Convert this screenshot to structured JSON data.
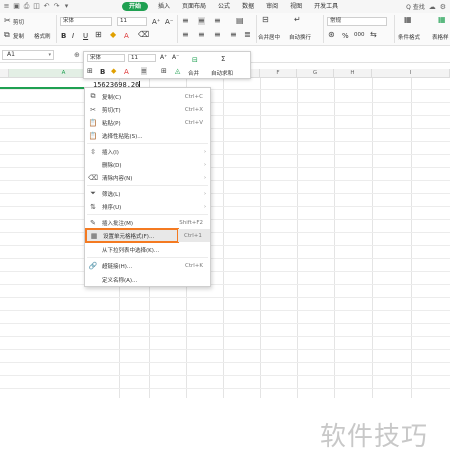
{
  "tabs": {
    "file_menu": "≡",
    "items": [
      "开始",
      "插入",
      "页面布局",
      "公式",
      "数据",
      "审阅",
      "视图",
      "开发工具"
    ],
    "active": "开始",
    "search": "Q 查找"
  },
  "ribbon": {
    "cut": "剪切",
    "copy": "复制",
    "format_painter": "格式刷",
    "paste": "粘贴",
    "font_name": "宋体",
    "font_size": "11",
    "style_name": "常规",
    "merge_center": "合并居中",
    "auto_wrap": "自动换行",
    "conditional_format": "条件格式",
    "table_style": "表格样",
    "bold": "B",
    "italic": "I",
    "underline": "U",
    "percent": "%",
    "thousands": "000"
  },
  "formula_bar": {
    "cell_ref": "A1",
    "zoom_icon": "⊕"
  },
  "mini_toolbar": {
    "font_name": "宋体",
    "font_size": "11",
    "grow_font": "A⁺",
    "shrink_font": "A⁻",
    "bold": "B",
    "merge": "合并",
    "autosum": "自动求和"
  },
  "columns": [
    "A",
    "B",
    "C",
    "D",
    "E",
    "F",
    "G",
    "H",
    "I"
  ],
  "cell_value": "15623698.26",
  "context_menu": [
    {
      "icon": "⧉",
      "label": "复制(C)",
      "shortcut": "Ctrl+C",
      "arrow": ""
    },
    {
      "icon": "✂",
      "label": "剪切(T)",
      "shortcut": "Ctrl+X",
      "arrow": ""
    },
    {
      "icon": "📋",
      "label": "粘贴(P)",
      "shortcut": "Ctrl+V",
      "arrow": ""
    },
    {
      "icon": "📋",
      "label": "选择性粘贴(S)...",
      "shortcut": "",
      "arrow": ""
    },
    {
      "icon": "⇳",
      "label": "插入(I)",
      "shortcut": "",
      "arrow": "›"
    },
    {
      "icon": "",
      "label": "删除(D)",
      "shortcut": "",
      "arrow": "›"
    },
    {
      "icon": "⌫",
      "label": "清除内容(N)",
      "shortcut": "",
      "arrow": "›"
    },
    {
      "icon": "⏷",
      "label": "筛选(L)",
      "shortcut": "",
      "arrow": "›"
    },
    {
      "icon": "⇅",
      "label": "排序(U)",
      "shortcut": "",
      "arrow": "›"
    },
    {
      "icon": "✎",
      "label": "插入批注(M)",
      "shortcut": "Shift+F2",
      "arrow": ""
    },
    {
      "icon": "▦",
      "label": "设置单元格格式(F)...",
      "shortcut": "Ctrl+1",
      "arrow": ""
    },
    {
      "icon": "",
      "label": "从下拉列表中选择(K)...",
      "shortcut": "",
      "arrow": ""
    },
    {
      "icon": "🔗",
      "label": "超链接(H)...",
      "shortcut": "Ctrl+K",
      "arrow": ""
    },
    {
      "icon": "",
      "label": "定义名称(A)...",
      "shortcut": "",
      "arrow": ""
    }
  ],
  "watermark": "软件技巧",
  "colors": {
    "accent_green": "#1fa051",
    "highlight_border": "#f47a21"
  }
}
